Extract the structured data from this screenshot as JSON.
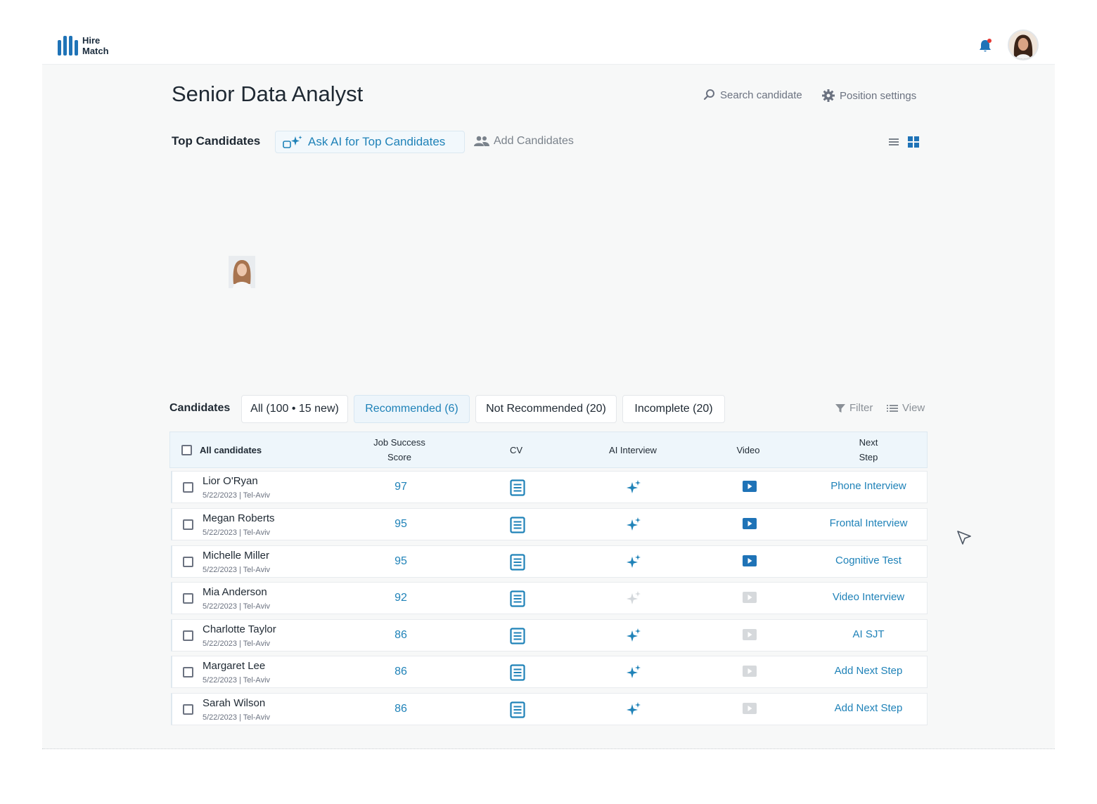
{
  "app": {
    "logo_line1": "Hire",
    "logo_line2": "Match"
  },
  "header": {
    "title": "Senior Data Analyst",
    "search_label": "Search candidate",
    "settings_label": "Position settings"
  },
  "top_candidates": {
    "label": "Top Candidates",
    "ask_ai_label": "Ask AI for Top Candidates",
    "add_label": "Add Candidates"
  },
  "candidates": {
    "label": "Candidates",
    "tabs": [
      {
        "label": "All (100 • 15 new)",
        "active": false
      },
      {
        "label": "Recommended (6)",
        "active": true
      },
      {
        "label": "Not Recommended (20)",
        "active": false
      },
      {
        "label": "Incomplete (20)",
        "active": false
      }
    ],
    "filter_label": "Filter",
    "view_label": "View"
  },
  "table": {
    "headers": {
      "all": "All candidates",
      "score_line1": "Job Success",
      "score_line2": "Score",
      "cv": "CV",
      "ai": "AI Interview",
      "video": "Video",
      "next_line1": "Next",
      "next_line2": "Step"
    },
    "rows": [
      {
        "name": "Lior O'Ryan",
        "meta": "5/22/2023 | Tel-Aviv",
        "score": "97",
        "ai": true,
        "video": true,
        "next": "Phone Interview"
      },
      {
        "name": "Megan Roberts",
        "meta": "5/22/2023 | Tel-Aviv",
        "score": "95",
        "ai": true,
        "video": true,
        "next": "Frontal Interview"
      },
      {
        "name": "Michelle Miller",
        "meta": "5/22/2023 | Tel-Aviv",
        "score": "95",
        "ai": true,
        "video": true,
        "next": "Cognitive Test"
      },
      {
        "name": "Mia Anderson",
        "meta": "5/22/2023 | Tel-Aviv",
        "score": "92",
        "ai": false,
        "video": false,
        "next": "Video Interview"
      },
      {
        "name": "Charlotte Taylor",
        "meta": "5/22/2023 | Tel-Aviv",
        "score": "86",
        "ai": true,
        "video": false,
        "next": "AI SJT"
      },
      {
        "name": "Margaret Lee",
        "meta": "5/22/2023 | Tel-Aviv",
        "score": "86",
        "ai": true,
        "video": false,
        "next": "Add Next Step"
      },
      {
        "name": "Sarah Wilson",
        "meta": "5/22/2023 | Tel-Aviv",
        "score": "86",
        "ai": true,
        "video": false,
        "next": "Add Next Step"
      }
    ]
  },
  "colors": {
    "accent": "#1f82b8",
    "brand": "#1f73b7",
    "notification": "#e53935"
  },
  "icons": [
    "bell-icon",
    "search-icon",
    "gear-icon",
    "sparkle-icon",
    "people-icon",
    "list-view-icon",
    "grid-view-icon",
    "filter-icon",
    "view-list-icon",
    "cv-document-icon",
    "ai-sparkle-icon",
    "video-play-icon",
    "cursor-icon"
  ]
}
